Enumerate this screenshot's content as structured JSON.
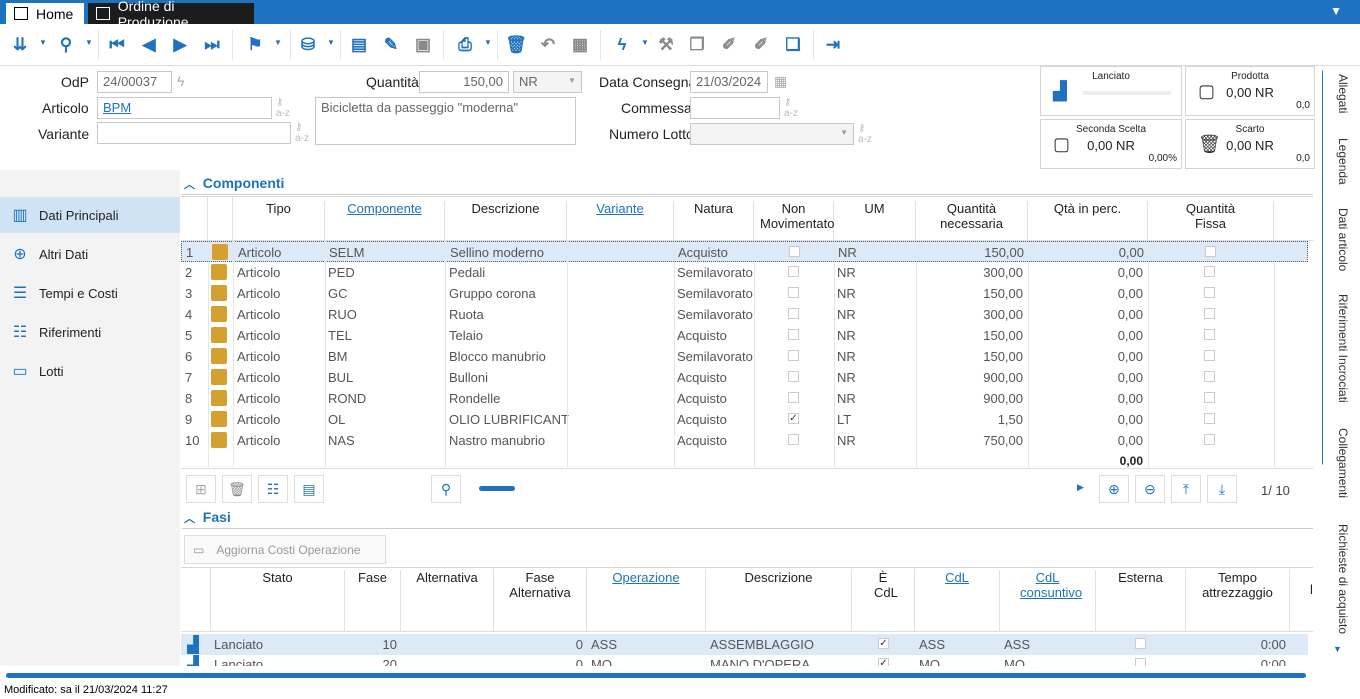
{
  "tabs": {
    "home": "Home",
    "document": "Ordine di Produzione"
  },
  "header": {
    "odp_label": "OdP",
    "odp_value": "24/00037",
    "quantita_label": "Quantità",
    "quantita_value": "150,00",
    "um_value": "NR",
    "data_consegna_label": "Data Consegna",
    "data_consegna_value": "21/03/2024",
    "articolo_label": "Articolo",
    "articolo_value": "BPM",
    "descrizione_value": "Bicicletta da passeggio \"moderna\"",
    "commessa_label": "Commessa",
    "commessa_value": "",
    "variante_label": "Variante",
    "variante_value": "",
    "numero_lotto_label": "Numero Lotto",
    "numero_lotto_value": "",
    "az": "a-z"
  },
  "cards": {
    "lanciato": {
      "title": "Lanciato"
    },
    "prodotta": {
      "title": "Prodotta",
      "value": "0,00 NR",
      "perc": "0,0"
    },
    "seconda_scelta": {
      "title": "Seconda Scelta",
      "value": "0,00 NR",
      "perc": "0,00%"
    },
    "scarto": {
      "title": "Scarto",
      "value": "0,00 NR",
      "perc": "0,0"
    }
  },
  "right_tabs": [
    "Allegati",
    "Legenda",
    "Dati articolo",
    "Riferimenti Incrociati",
    "Collegamenti",
    "Richieste di acquisto"
  ],
  "nav": {
    "items": [
      {
        "label": "Dati Principali"
      },
      {
        "label": "Altri Dati"
      },
      {
        "label": "Tempi e Costi"
      },
      {
        "label": "Riferimenti"
      },
      {
        "label": "Lotti"
      }
    ]
  },
  "componenti": {
    "title": "Componenti",
    "headers": {
      "tipo": "Tipo",
      "componente": "Componente",
      "descrizione": "Descrizione",
      "variante": "Variante",
      "natura": "Natura",
      "non_mov": "Non Movimentato",
      "um": "UM",
      "qta_nec": "Quantità necessaria",
      "qta_perc": "Qtà in perc.",
      "qta_fissa": "Quantità Fissa"
    },
    "rows": [
      {
        "n": "1",
        "tipo": "Articolo",
        "comp": "SELM",
        "desc": "Sellino moderno",
        "natura": "Acquisto",
        "nonmov": "",
        "um": "NR",
        "qta": "150,00",
        "perc": "0,00"
      },
      {
        "n": "2",
        "tipo": "Articolo",
        "comp": "PED",
        "desc": "Pedali",
        "natura": "Semilavorato",
        "nonmov": "",
        "um": "NR",
        "qta": "300,00",
        "perc": "0,00"
      },
      {
        "n": "3",
        "tipo": "Articolo",
        "comp": "GC",
        "desc": "Gruppo corona",
        "natura": "Semilavorato",
        "nonmov": "",
        "um": "NR",
        "qta": "150,00",
        "perc": "0,00"
      },
      {
        "n": "4",
        "tipo": "Articolo",
        "comp": "RUO",
        "desc": "Ruota",
        "natura": "Semilavorato",
        "nonmov": "",
        "um": "NR",
        "qta": "300,00",
        "perc": "0,00"
      },
      {
        "n": "5",
        "tipo": "Articolo",
        "comp": "TEL",
        "desc": "Telaio",
        "natura": "Acquisto",
        "nonmov": "",
        "um": "NR",
        "qta": "150,00",
        "perc": "0,00"
      },
      {
        "n": "6",
        "tipo": "Articolo",
        "comp": "BM",
        "desc": "Blocco manubrio",
        "natura": "Semilavorato",
        "nonmov": "",
        "um": "NR",
        "qta": "150,00",
        "perc": "0,00"
      },
      {
        "n": "7",
        "tipo": "Articolo",
        "comp": "BUL",
        "desc": "Bulloni",
        "natura": "Acquisto",
        "nonmov": "",
        "um": "NR",
        "qta": "900,00",
        "perc": "0,00"
      },
      {
        "n": "8",
        "tipo": "Articolo",
        "comp": "ROND",
        "desc": "Rondelle",
        "natura": "Acquisto",
        "nonmov": "",
        "um": "NR",
        "qta": "900,00",
        "perc": "0,00"
      },
      {
        "n": "9",
        "tipo": "Articolo",
        "comp": "OL",
        "desc": "OLIO LUBRIFICANTE",
        "natura": "Acquisto",
        "nonmov": "✓",
        "um": "LT",
        "qta": "1,50",
        "perc": "0,00"
      },
      {
        "n": "10",
        "tipo": "Articolo",
        "comp": "NAS",
        "desc": "Nastro manubrio",
        "natura": "Acquisto",
        "nonmov": "",
        "um": "NR",
        "qta": "750,00",
        "perc": "0,00"
      }
    ],
    "total_perc": "0,00",
    "pager": "1/  10"
  },
  "fasi": {
    "title": "Fasi",
    "aggiorna_btn": "Aggiorna Costi Operazione",
    "headers": {
      "stato": "Stato",
      "fase": "Fase",
      "alternativa": "Alternativa",
      "fase_alt": "Fase Alternativa",
      "operazione": "Operazione",
      "descrizione": "Descrizione",
      "e_cdl": "È CdL",
      "cdl": "CdL",
      "cdl_cons": "CdL consuntivo",
      "esterna": "Esterna",
      "tempo_att": "Tempo attrezzaggio",
      "extra": "l:"
    },
    "rows": [
      {
        "stato": "Lanciato",
        "fase": "10",
        "fase_alt": "0",
        "op": "ASS",
        "desc": "ASSEMBLAGGIO",
        "ecdl": "✓",
        "cdl": "ASS",
        "cdlc": "ASS",
        "tempo": "0:00"
      },
      {
        "stato": "Lanciato",
        "fase": "20",
        "fase_alt": "0",
        "op": "MO",
        "desc": "MANO D'OPERA",
        "ecdl": "✓",
        "cdl": "MO",
        "cdlc": "MO",
        "tempo": "0:00"
      }
    ]
  },
  "status": "Modificato: sa il 21/03/2024 11:27"
}
